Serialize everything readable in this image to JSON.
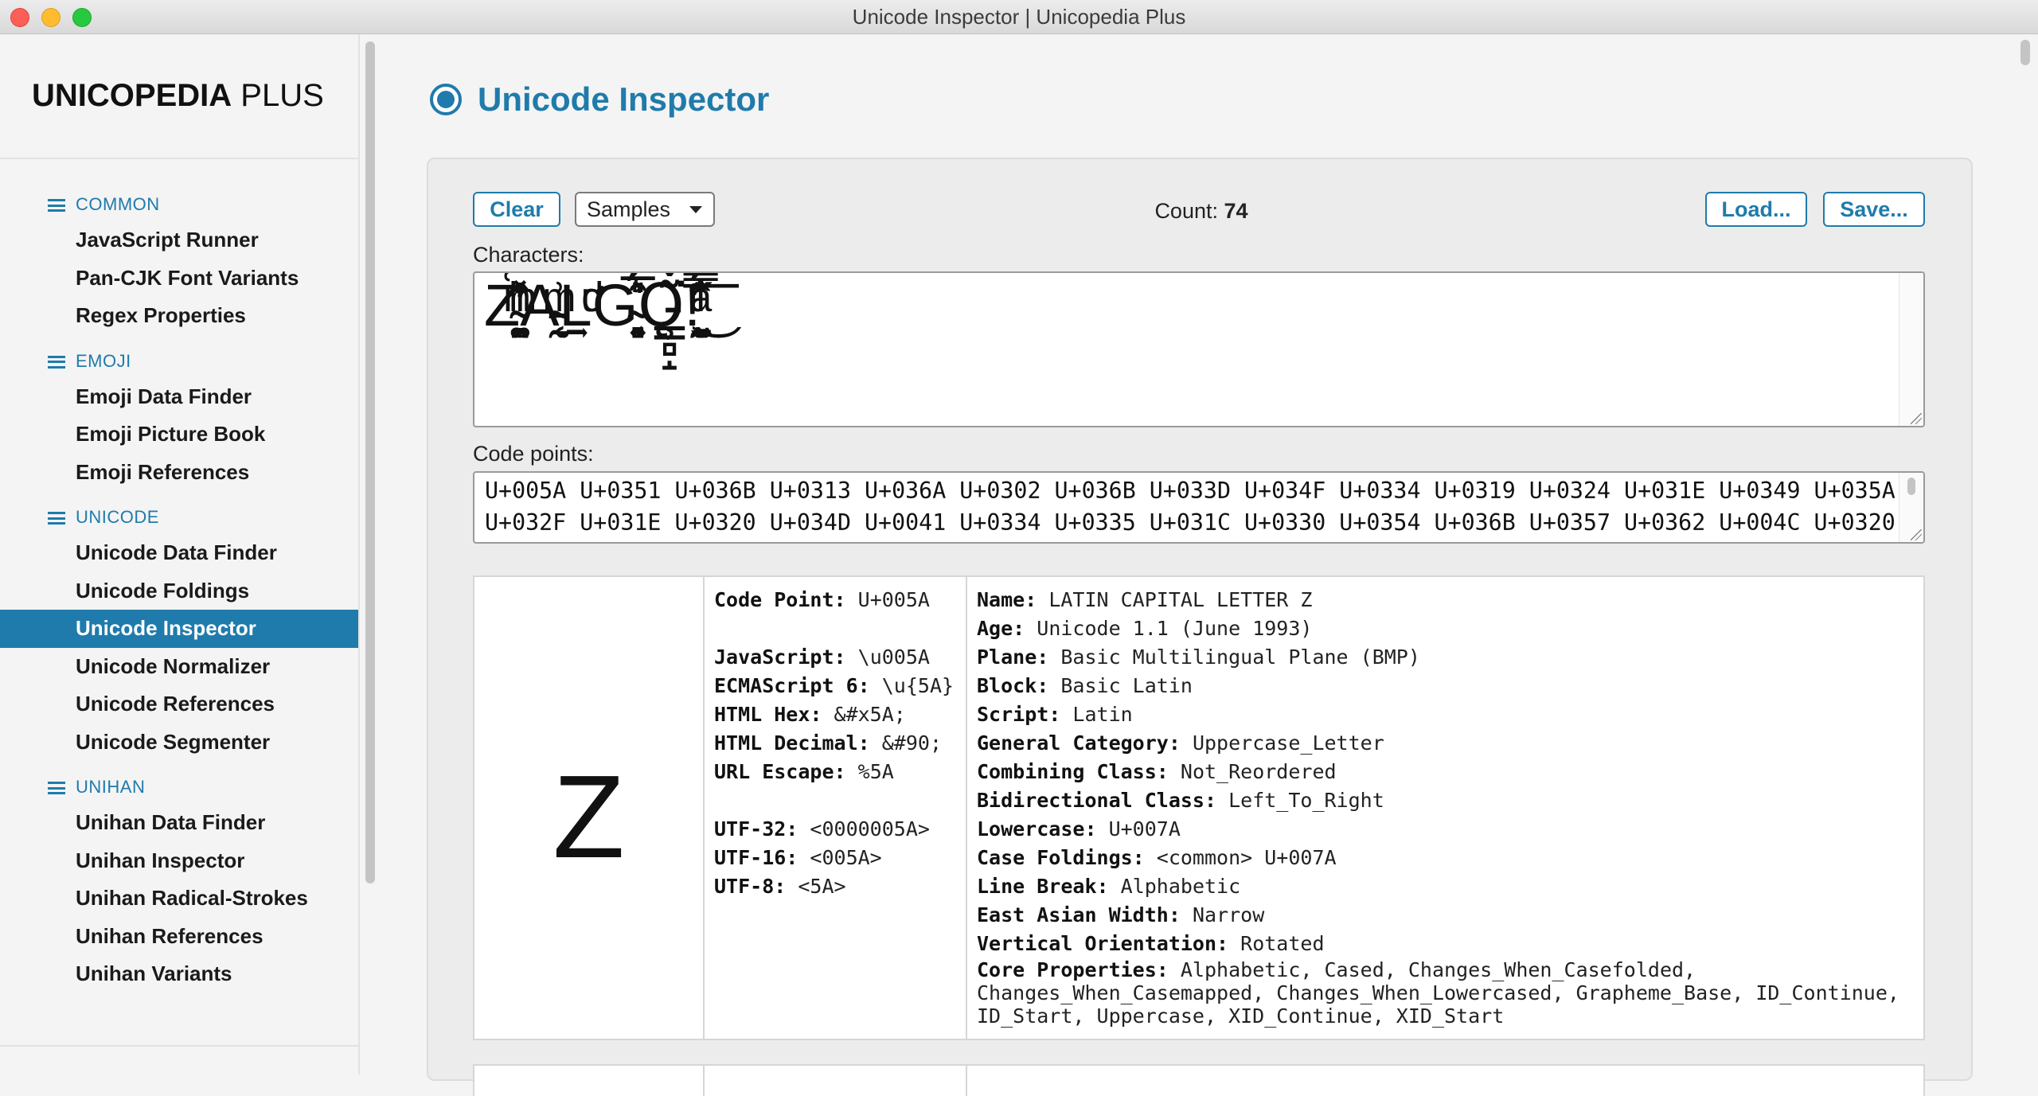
{
  "window": {
    "title": "Unicode Inspector | Unicopedia Plus"
  },
  "brand": {
    "bold": "UNICOPEDIA",
    "light": "PLUS"
  },
  "sidebar": {
    "sections": [
      {
        "header": "COMMON",
        "items": [
          "JavaScript Runner",
          "Pan-CJK Font Variants",
          "Regex Properties"
        ]
      },
      {
        "header": "EMOJI",
        "items": [
          "Emoji Data Finder",
          "Emoji Picture Book",
          "Emoji References"
        ]
      },
      {
        "header": "UNICODE",
        "items": [
          "Unicode Data Finder",
          "Unicode Foldings",
          "Unicode Inspector",
          "Unicode Normalizer",
          "Unicode References",
          "Unicode Segmenter"
        ]
      },
      {
        "header": "UNIHAN",
        "items": [
          "Unihan Data Finder",
          "Unihan Inspector",
          "Unihan Radical-Strokes",
          "Unihan References",
          "Unihan Variants"
        ]
      }
    ],
    "active": "Unicode Inspector"
  },
  "page": {
    "title": "Unicode Inspector"
  },
  "toolbar": {
    "clear": "Clear",
    "samples": "Samples",
    "count_label": "Count:",
    "count_value": "74",
    "load": "Load...",
    "save": "Save..."
  },
  "characters": {
    "label": "Characters:",
    "value": "Z͑ͫ̓ͪ̂ͫ̽͏̴̙̤̞͉͚̯̞̠͍A̴̵̜̰͔ͫ͗͢L̠ͨͧͩ͘G̴̻͈͍͔̹̑͗̎̅͛́Ǫ̵̹̻̝̳͂̌̌͘!͖̬̰̙̗̿̋ͥͥ̂ͣ̐́́͜͞"
  },
  "code_points": {
    "label": "Code points:",
    "value": "U+005A U+0351 U+036B U+0313 U+036A U+0302 U+036B U+033D U+034F U+0334 U+0319 U+0324 U+031E U+0349 U+035A U+032F U+031E U+0320 U+034D U+0041 U+0334 U+0335 U+031C U+0330 U+0354 U+036B U+0357 U+0362 U+004C U+0320"
  },
  "char_info": {
    "glyph": "Z",
    "codes": [
      {
        "k": "Code Point:",
        "v": "U+005A"
      },
      {
        "gap": true
      },
      {
        "k": "JavaScript:",
        "v": "\\u005A"
      },
      {
        "k": "ECMAScript 6:",
        "v": "\\u{5A}"
      },
      {
        "k": "HTML Hex:",
        "v": "&#x5A;"
      },
      {
        "k": "HTML Decimal:",
        "v": "&#90;"
      },
      {
        "k": "URL Escape:",
        "v": "%5A"
      },
      {
        "gap": true
      },
      {
        "k": "UTF-32:",
        "v": "<0000005A>"
      },
      {
        "k": "UTF-16:",
        "v": "<005A>"
      },
      {
        "k": "UTF-8:",
        "v": "<5A>"
      }
    ],
    "props": [
      {
        "k": "Name:",
        "v": "LATIN CAPITAL LETTER Z"
      },
      {
        "k": "Age:",
        "v": "Unicode 1.1 (June 1993)"
      },
      {
        "k": "Plane:",
        "v": "Basic Multilingual Plane (BMP)"
      },
      {
        "k": "Block:",
        "v": "Basic Latin"
      },
      {
        "k": "Script:",
        "v": "Latin"
      },
      {
        "k": "General Category:",
        "v": "Uppercase_Letter"
      },
      {
        "k": "Combining Class:",
        "v": "Not_Reordered"
      },
      {
        "k": "Bidirectional Class:",
        "v": "Left_To_Right"
      },
      {
        "k": "Lowercase:",
        "v": "U+007A"
      },
      {
        "k": "Case Foldings:",
        "v": "<common> U+007A"
      },
      {
        "k": "Line Break:",
        "v": "Alphabetic"
      },
      {
        "k": "East Asian Width:",
        "v": "Narrow"
      },
      {
        "k": "Vertical Orientation:",
        "v": "Rotated"
      },
      {
        "k": "Core Properties:",
        "v": "Alphabetic, Cased, Changes_When_Casefolded, Changes_When_Casemapped, Changes_When_Lowercased, Grapheme_Base, ID_Continue, ID_Start, Uppercase, XID_Continue, XID_Start",
        "wrap": true
      }
    ]
  },
  "colors": {
    "accent": "#1f7bab",
    "active_bg": "#1f7bab",
    "panel_bg": "#ececec"
  }
}
